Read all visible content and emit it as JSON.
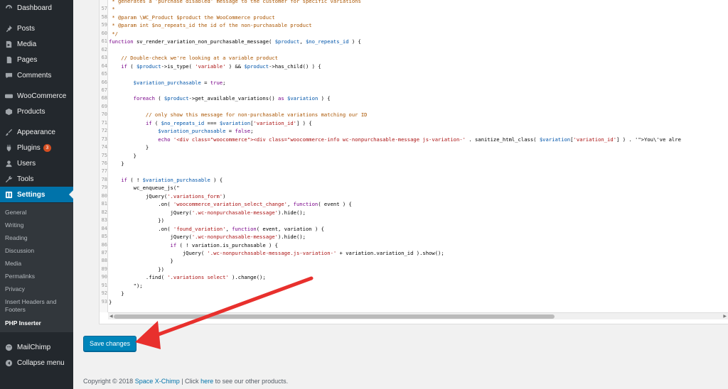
{
  "sidebar": {
    "items": [
      {
        "label": "Dashboard",
        "icon": "dashboard-icon"
      },
      {
        "label": "Posts",
        "icon": "pin-icon"
      },
      {
        "label": "Media",
        "icon": "media-icon"
      },
      {
        "label": "Pages",
        "icon": "pages-icon"
      },
      {
        "label": "Comments",
        "icon": "comment-icon"
      },
      {
        "label": "WooCommerce",
        "icon": "woocommerce-icon"
      },
      {
        "label": "Products",
        "icon": "products-icon"
      },
      {
        "label": "Appearance",
        "icon": "brush-icon"
      },
      {
        "label": "Plugins",
        "icon": "plugin-icon",
        "badge": "3"
      },
      {
        "label": "Users",
        "icon": "users-icon"
      },
      {
        "label": "Tools",
        "icon": "wrench-icon"
      },
      {
        "label": "Settings",
        "icon": "settings-icon",
        "active": true
      },
      {
        "label": "MailChimp",
        "icon": "mailchimp-icon"
      },
      {
        "label": "Collapse menu",
        "icon": "collapse-icon"
      }
    ],
    "submenu": [
      {
        "label": "General"
      },
      {
        "label": "Writing"
      },
      {
        "label": "Reading"
      },
      {
        "label": "Discussion"
      },
      {
        "label": "Media"
      },
      {
        "label": "Permalinks"
      },
      {
        "label": "Privacy"
      },
      {
        "label": "Insert Headers and Footers"
      },
      {
        "label": "PHP Inserter",
        "current": true
      }
    ]
  },
  "editor": {
    "lines": [
      {
        "n": "",
        "text": " * generates a 'purchase disabled' message to the customer for specific variations"
      },
      {
        "n": "57",
        "text": " *"
      },
      {
        "n": "58",
        "text": " * @param \\WC_Product $product the WooCommerce product"
      },
      {
        "n": "59",
        "text": " * @param int $no_repeats_id the id of the non-purchasable product"
      },
      {
        "n": "60",
        "text": " */"
      },
      {
        "n": "61",
        "text": "function sv_render_variation_non_purchasable_message( $product, $no_repeats_id ) {"
      },
      {
        "n": "62",
        "text": ""
      },
      {
        "n": "63",
        "text": "    // Double-check we're looking at a variable product"
      },
      {
        "n": "64",
        "text": "    if ( $product->is_type( 'variable' ) && $product->has_child() ) {"
      },
      {
        "n": "65",
        "text": ""
      },
      {
        "n": "66",
        "text": "        $variation_purchasable = true;"
      },
      {
        "n": "67",
        "text": ""
      },
      {
        "n": "68",
        "text": "        foreach ( $product->get_available_variations() as $variation ) {"
      },
      {
        "n": "69",
        "text": ""
      },
      {
        "n": "70",
        "text": "            // only show this message for non-purchasable variations matching our ID"
      },
      {
        "n": "71",
        "text": "            if ( $no_repeats_id === $variation['variation_id'] ) {"
      },
      {
        "n": "72",
        "text": "                $variation_purchasable = false;"
      },
      {
        "n": "73",
        "text": "                echo '<div class=\"woocommerce\"><div class=\"woocommerce-info wc-nonpurchasable-message js-variation-' . sanitize_html_class( $variation['variation_id'] ) . '\">You\\'ve alre"
      },
      {
        "n": "74",
        "text": "            }"
      },
      {
        "n": "75",
        "text": "        }"
      },
      {
        "n": "76",
        "text": "    }"
      },
      {
        "n": "77",
        "text": ""
      },
      {
        "n": "78",
        "text": "    if ( ! $variation_purchasable ) {"
      },
      {
        "n": "79",
        "text": "        wc_enqueue_js(\""
      },
      {
        "n": "80",
        "text": "            jQuery('.variations_form')"
      },
      {
        "n": "81",
        "text": "                .on( 'woocommerce_variation_select_change', function( event ) {"
      },
      {
        "n": "82",
        "text": "                    jQuery('.wc-nonpurchasable-message').hide();"
      },
      {
        "n": "83",
        "text": "                })"
      },
      {
        "n": "84",
        "text": "                .on( 'found_variation', function( event, variation ) {"
      },
      {
        "n": "85",
        "text": "                    jQuery('.wc-nonpurchasable-message').hide();"
      },
      {
        "n": "86",
        "text": "                    if ( ! variation.is_purchasable ) {"
      },
      {
        "n": "87",
        "text": "                        jQuery( '.wc-nonpurchasable-message.js-variation-' + variation.variation_id ).show();"
      },
      {
        "n": "88",
        "text": "                    }"
      },
      {
        "n": "89",
        "text": "                })"
      },
      {
        "n": "90",
        "text": "            .find( '.variations select' ).change();"
      },
      {
        "n": "91",
        "text": "        \");"
      },
      {
        "n": "92",
        "text": "    }"
      },
      {
        "n": "93",
        "text": "}"
      }
    ]
  },
  "save_button": {
    "label": "Save changes"
  },
  "footer": {
    "prefix": "Copyright © 2018 ",
    "company_link": "Space X-Chimp",
    "middle": " | Click ",
    "here_link": "here",
    "suffix": " to see our other products."
  },
  "colors": {
    "sidebar_bg": "#23282d",
    "active_bg": "#0073aa",
    "button_bg": "#0085ba",
    "arrow": "#e8302d"
  }
}
